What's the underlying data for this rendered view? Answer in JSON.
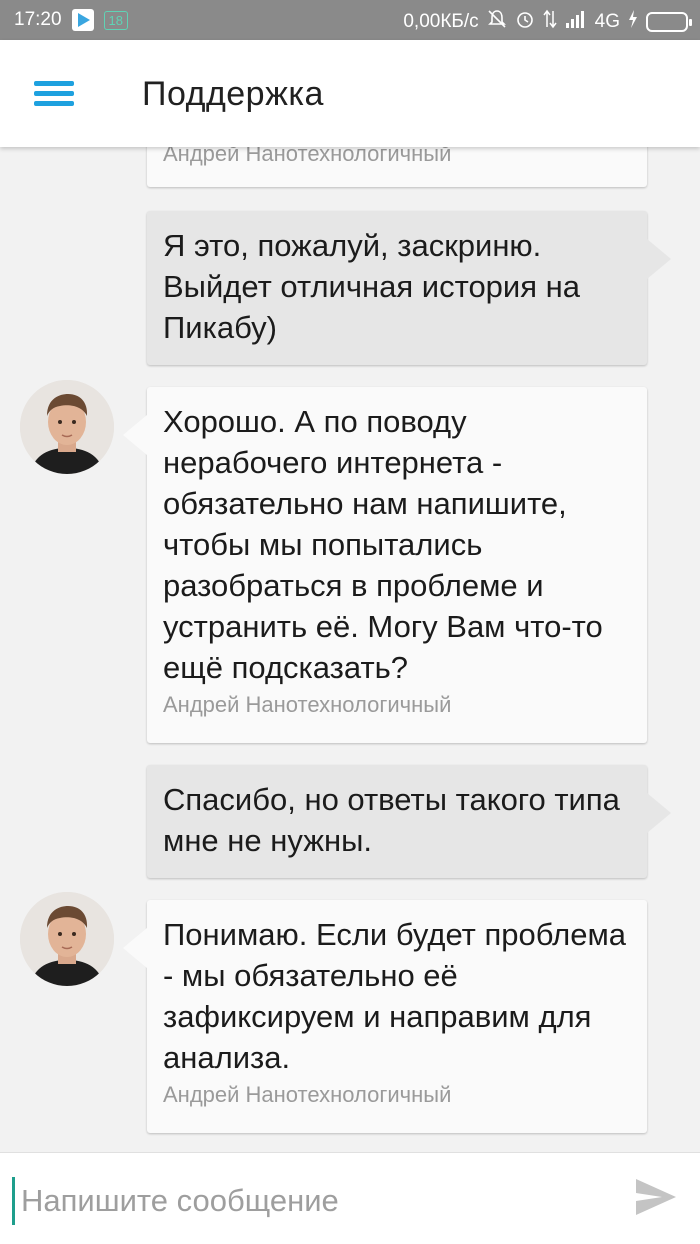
{
  "status_bar": {
    "time": "17:20",
    "notification_count": "18",
    "network_speed": "0,00КБ/с",
    "network_type": "4G",
    "icons": [
      "play-store-icon",
      "mute-icon",
      "alarm-icon",
      "signal-icon",
      "charging-icon",
      "battery-icon"
    ]
  },
  "app_bar": {
    "title": "Поддержка",
    "menu_icon": "hamburger-menu-icon",
    "accent_color": "#1ea1df"
  },
  "messages": [
    {
      "direction": "in",
      "text": "",
      "author": "Андрей Нанотехнологичный",
      "partial": true
    },
    {
      "direction": "out",
      "text": "Я это, пожалуй, заскриню. Выйдет отличная история на Пикабу)"
    },
    {
      "direction": "in",
      "text": "Хорошо. А по поводу нерабочего интернета - обязательно нам напишите, чтобы мы попытались разобраться в проблеме и устранить её. Могу Вам что-то ещё подсказать?",
      "author": "Андрей Нанотехнологичный"
    },
    {
      "direction": "out",
      "text": "Спасибо, но ответы такого типа мне не нужны."
    },
    {
      "direction": "in",
      "text": "Понимаю. Если будет проблема - мы обязательно её зафиксируем и направим для анализа.",
      "author": "Андрей Нанотехнологичный"
    }
  ],
  "composer": {
    "placeholder": "Напишите сообщение",
    "send_icon": "send-icon"
  }
}
